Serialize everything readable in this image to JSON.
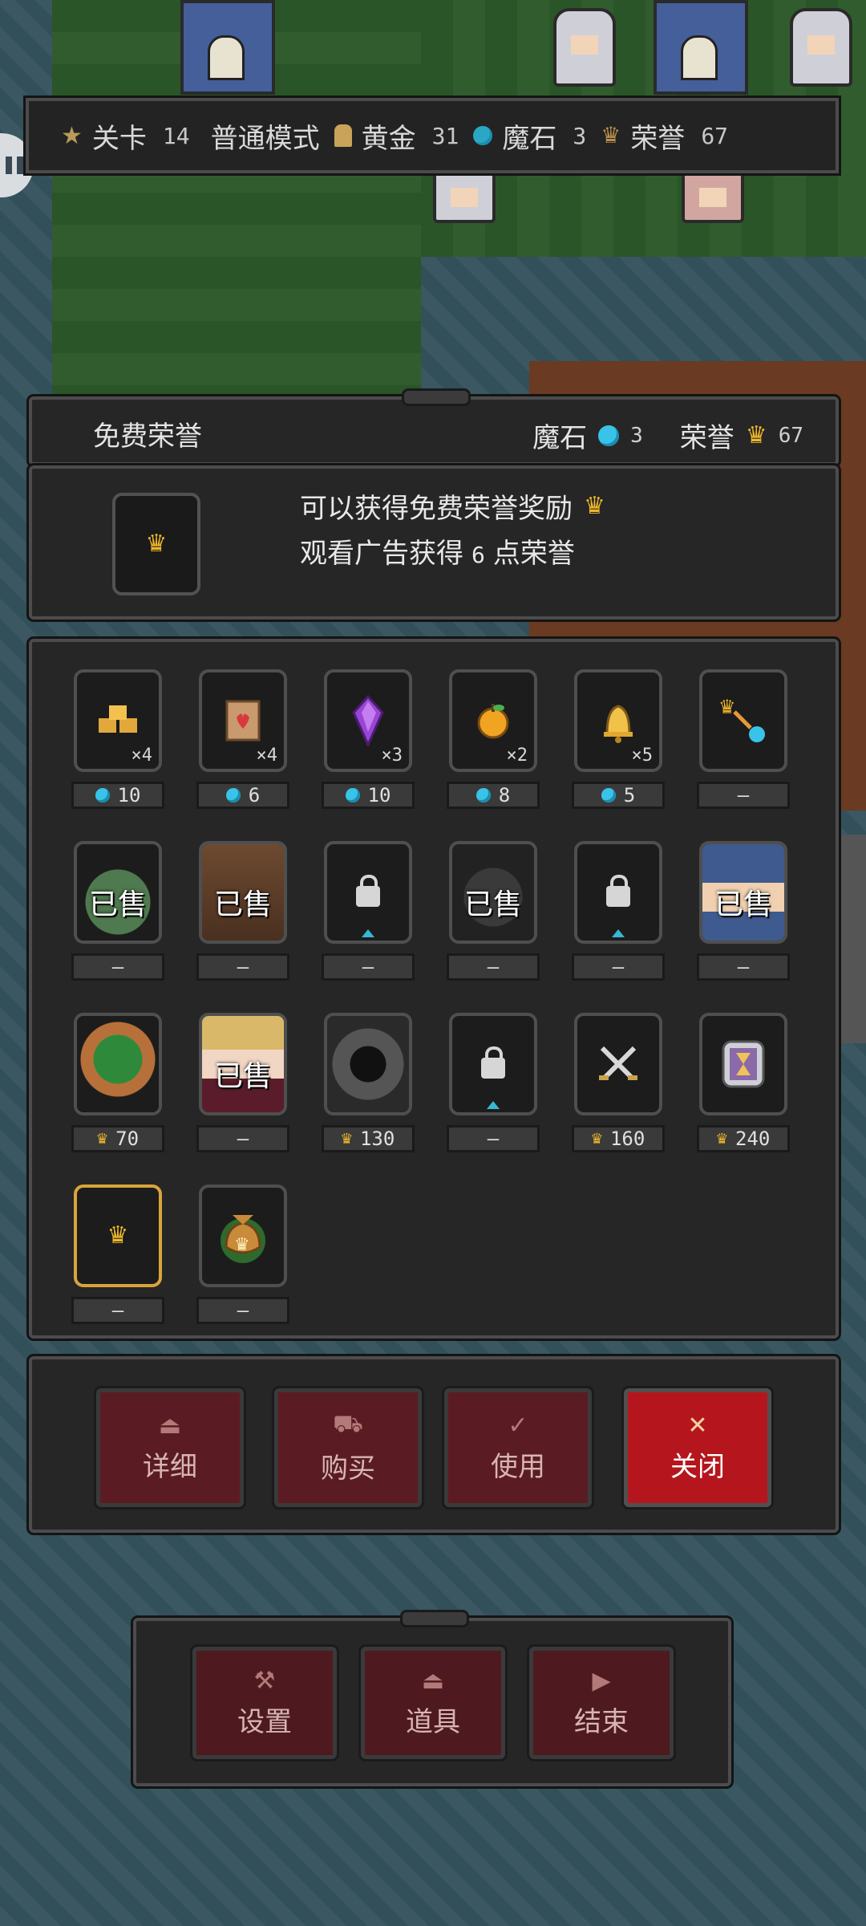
{
  "top_bar": {
    "level_label": "关卡",
    "level_value": "14",
    "mode": "普通模式",
    "gold_label": "黄金",
    "gold_value": "31",
    "magic_stone_label": "魔石",
    "magic_stone_value": "3",
    "honor_label": "荣誉",
    "honor_value": "67"
  },
  "header": {
    "title": "免费荣誉",
    "magic_stone_label": "魔石",
    "magic_stone_value": "3",
    "honor_label": "荣誉",
    "honor_value": "67"
  },
  "info": {
    "line1": "可以获得免费荣誉奖励",
    "line2_prefix": "观看广告获得",
    "line2_value": "6",
    "line2_suffix": "点荣誉"
  },
  "shop": {
    "row1": [
      {
        "icon": "gold-bars-icon",
        "qty": "×4",
        "currency": "gem",
        "price": "10"
      },
      {
        "icon": "heart-scroll-icon",
        "qty": "×4",
        "currency": "gem",
        "price": "6"
      },
      {
        "icon": "purple-crystal-icon",
        "qty": "×3",
        "currency": "gem",
        "price": "10"
      },
      {
        "icon": "golden-apple-icon",
        "qty": "×2",
        "currency": "gem",
        "price": "8"
      },
      {
        "icon": "golden-bell-icon",
        "qty": "×5",
        "currency": "gem",
        "price": "5"
      },
      {
        "icon": "crown-to-gem-exchange-icon",
        "qty": "",
        "currency": "none",
        "price": "—"
      }
    ],
    "row2": [
      {
        "icon": "green-slime-portrait",
        "sold": "已售",
        "price": "—"
      },
      {
        "icon": "tree-ent-portrait",
        "sold": "已售",
        "price": "—"
      },
      {
        "icon": "lock-icon",
        "sold": "",
        "price": "—"
      },
      {
        "icon": "hooded-mage-portrait",
        "sold": "已售",
        "price": "—"
      },
      {
        "icon": "lock-icon",
        "sold": "",
        "price": "—"
      },
      {
        "icon": "blue-knight-portrait",
        "sold": "已售",
        "price": "—"
      }
    ],
    "row3": [
      {
        "icon": "forest-guardian-portrait",
        "sold": "",
        "currency": "crown",
        "price": "70"
      },
      {
        "icon": "blonde-girl-portrait",
        "sold": "已售",
        "currency": "none",
        "price": "—"
      },
      {
        "icon": "dark-reaper-portrait",
        "sold": "",
        "currency": "crown",
        "price": "130"
      },
      {
        "icon": "lock-icon",
        "sold": "",
        "currency": "none",
        "price": "—"
      },
      {
        "icon": "crossed-swords-icon",
        "sold": "",
        "currency": "crown",
        "price": "160"
      },
      {
        "icon": "hourglass-icon",
        "sold": "",
        "currency": "crown",
        "price": "240"
      }
    ],
    "row4": [
      {
        "icon": "crown-icon",
        "price": "—",
        "selected": true
      },
      {
        "icon": "crown-bag-icon",
        "price": "—"
      }
    ]
  },
  "actions": {
    "details": "详细",
    "buy": "购买",
    "use": "使用",
    "close": "关闭"
  },
  "bottom_menu": {
    "settings": "设置",
    "items": "道具",
    "end": "结束"
  },
  "colors": {
    "accent_red": "#b5161d",
    "gem_blue": "#39c3e8",
    "crown_gold": "#f0b82a",
    "panel_bg": "#262626"
  }
}
